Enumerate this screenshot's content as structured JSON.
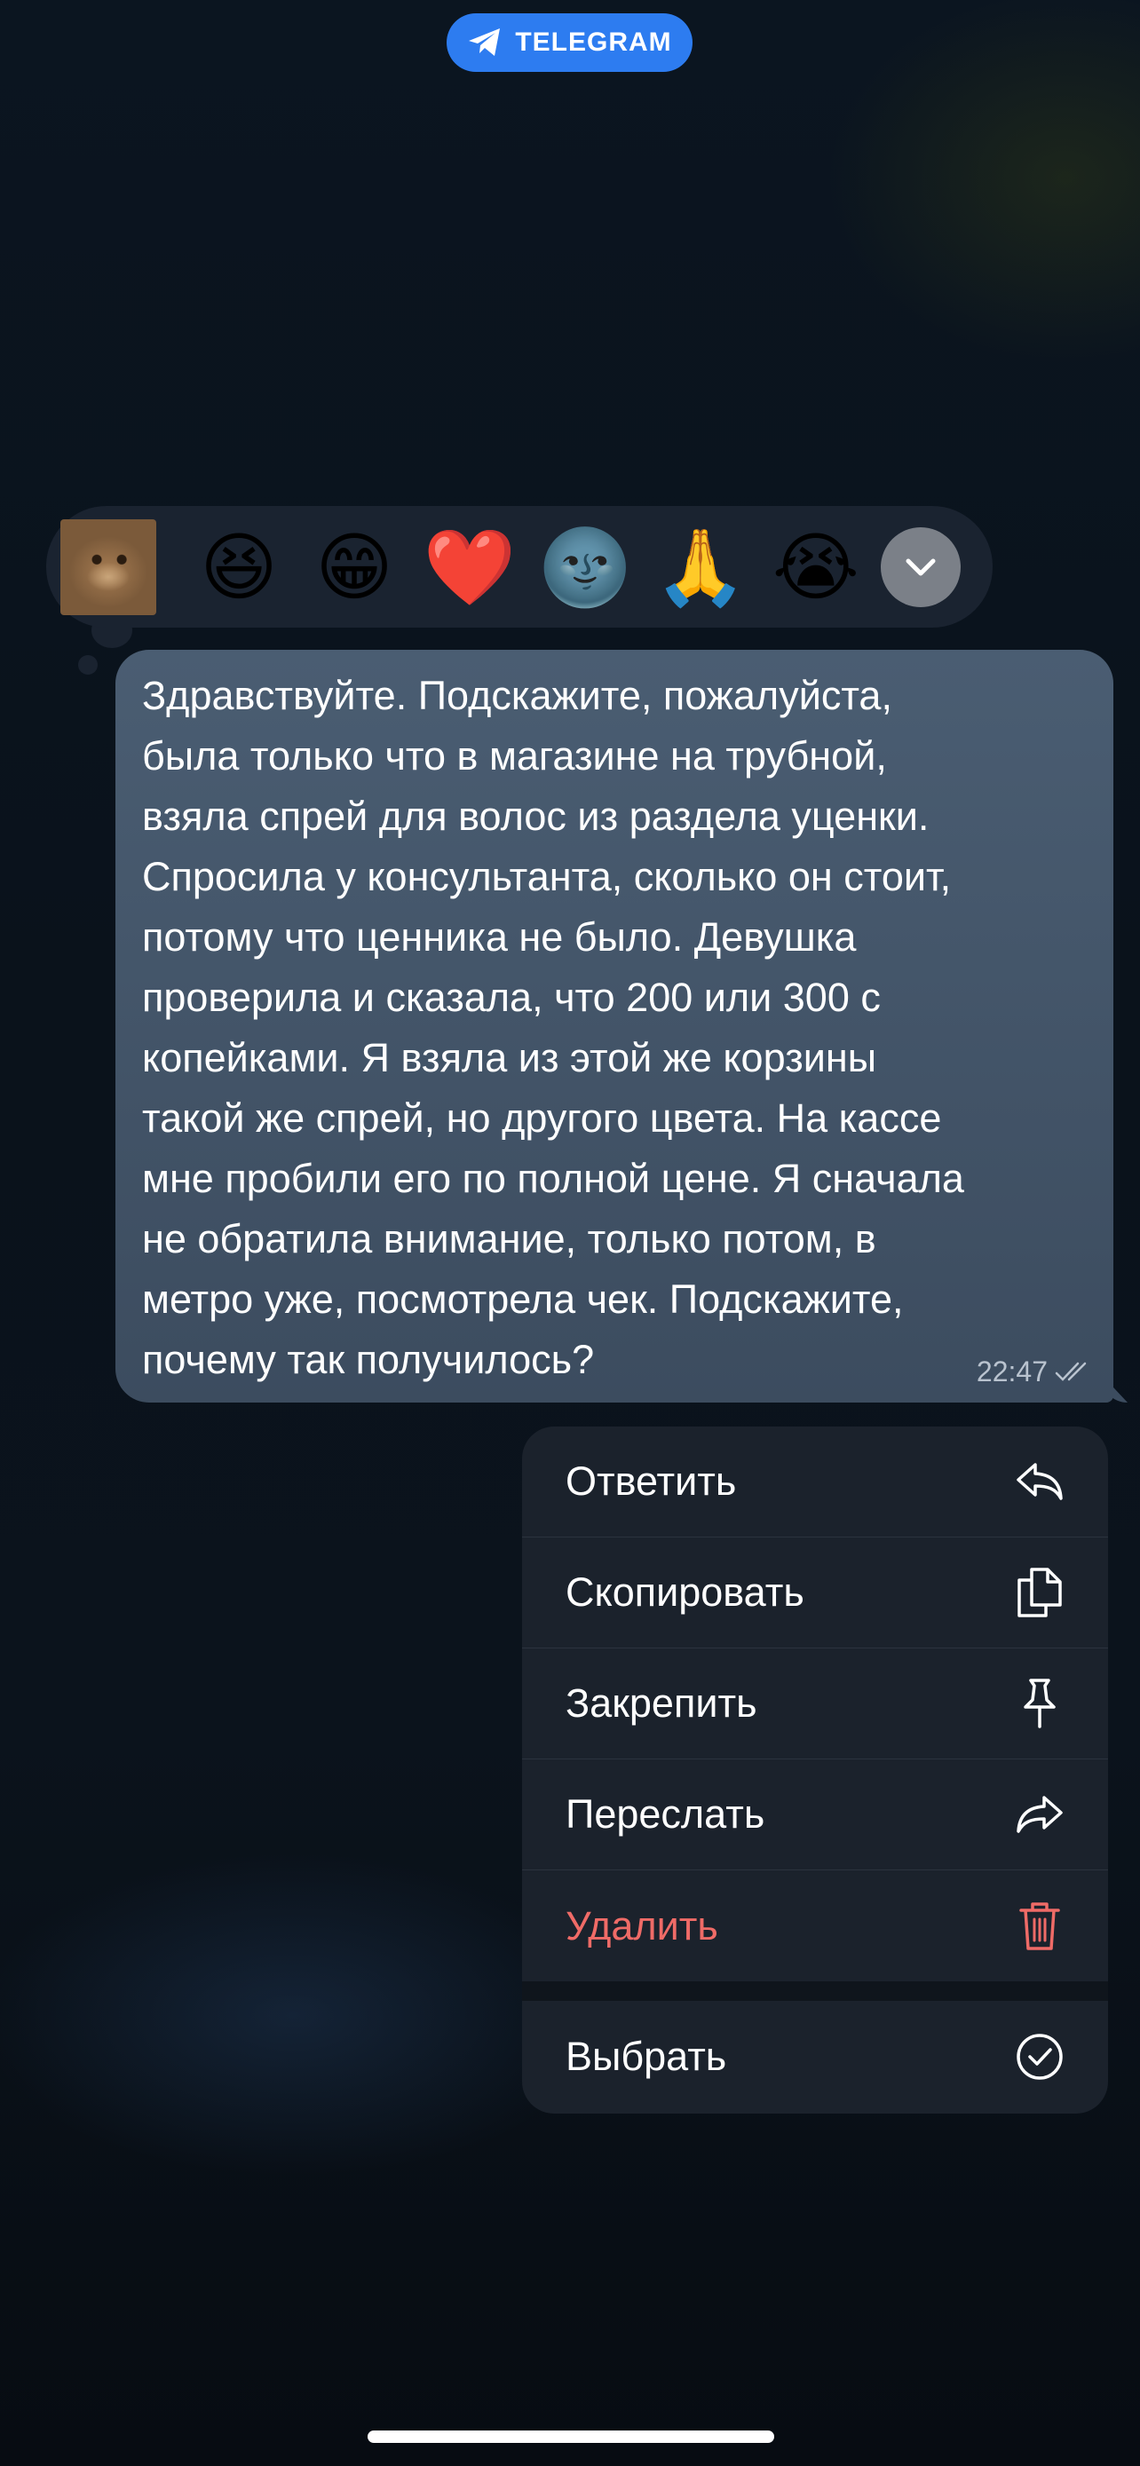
{
  "header": {
    "app_label": "TELEGRAM",
    "accent_color": "#2d7cf0"
  },
  "reactions": {
    "items": [
      {
        "name": "cat-sticker",
        "emoji": ""
      },
      {
        "name": "laughing",
        "emoji": "😆"
      },
      {
        "name": "grinning",
        "emoji": "😁"
      },
      {
        "name": "red-heart",
        "emoji": "❤️"
      },
      {
        "name": "new-moon-face",
        "emoji": "🌚"
      },
      {
        "name": "folded-hands",
        "emoji": "🙏"
      },
      {
        "name": "loudly-crying",
        "emoji": "😭"
      }
    ],
    "expand_icon": "chevron-down-icon"
  },
  "message": {
    "text": "Здравствуйте. Подскажите, пожалуйста,\nбыла только что в магазине на трубной,\nвзяла спрей для волос из раздела уценки.\nСпросила у консультанта, сколько он стоит,\nпотому что ценника не было. Девушка\nпроверила и сказала, что 200 или 300 с\nкопейками. Я взяла из этой же корзины\nтакой же спрей, но другого цвета. На кассе\nмне пробили его по полной цене. Я сначала\nне обратила внимание, только потом, в\nметро уже, посмотрела чек. Подскажите,\nпочему так получилось?",
    "time": "22:47",
    "status_icon": "double-check-icon"
  },
  "menu": {
    "reply": "Ответить",
    "copy": "Скопировать",
    "pin": "Закрепить",
    "forward": "Переслать",
    "delete": "Удалить",
    "select": "Выбрать",
    "danger_color": "#ef6b67"
  }
}
